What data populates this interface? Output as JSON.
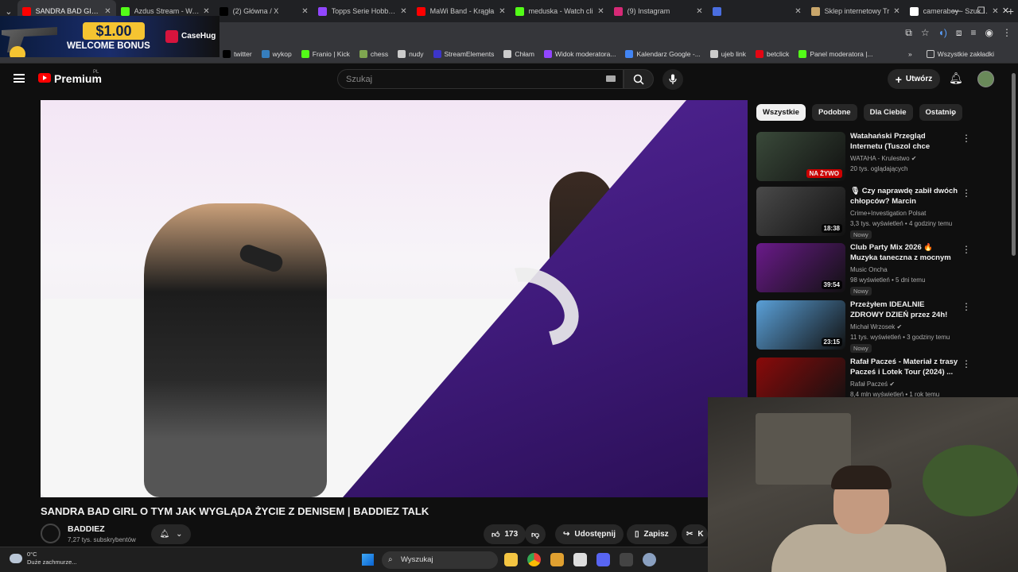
{
  "browser": {
    "tabs": [
      {
        "label": "SANDRA BAD GIRL O",
        "icon": "youtube-icon",
        "color": "#ff0000",
        "active": true
      },
      {
        "label": "Azdus Stream - Watc",
        "icon": "kick-icon",
        "color": "#53fc18",
        "active": false
      },
      {
        "label": "(2) Główna / X",
        "icon": "x-icon",
        "color": "#000000",
        "active": false
      },
      {
        "label": "Topps Serie Hobby B",
        "icon": "twitch-icon",
        "color": "#9146ff",
        "active": false
      },
      {
        "label": "MaWi Band - Krągła",
        "icon": "youtube-icon",
        "color": "#ff0000",
        "active": false
      },
      {
        "label": "meduska - Watch cli",
        "icon": "kick-icon",
        "color": "#53fc18",
        "active": false
      },
      {
        "label": "(9) Instagram",
        "icon": "instagram-icon",
        "color": "#d62976",
        "active": false
      },
      {
        "label": "",
        "icon": "window-icon",
        "color": "#4a6ee0",
        "active": false
      },
      {
        "label": "Sklep internetowy Tr",
        "icon": "shop-icon",
        "color": "#c9a66b",
        "active": false
      },
      {
        "label": "cameraboy - Szukaj w",
        "icon": "google-icon",
        "color": "#ffffff",
        "active": false
      }
    ],
    "bookmarks": [
      {
        "label": "twitter",
        "icon": "x-icon",
        "color": "#000000"
      },
      {
        "label": "wykop",
        "icon": "wykop-icon",
        "color": "#367ebd"
      },
      {
        "label": "Franio | Kick",
        "icon": "kick-icon",
        "color": "#53fc18"
      },
      {
        "label": "chess",
        "icon": "pawn-icon",
        "color": "#7fa650"
      },
      {
        "label": "nudy",
        "icon": "folder-icon",
        "color": "#cccccc"
      },
      {
        "label": "StreamElements",
        "icon": "streamelements-icon",
        "color": "#3c35c8"
      },
      {
        "label": "Chłam",
        "icon": "globe-icon",
        "color": "#cccccc"
      },
      {
        "label": "Widok moderatora...",
        "icon": "twitch-icon",
        "color": "#9146ff"
      },
      {
        "label": "Kalendarz Google -...",
        "icon": "calendar-icon",
        "color": "#4285f4"
      },
      {
        "label": "ujeb link",
        "icon": "globe-icon",
        "color": "#cccccc"
      },
      {
        "label": "betclick",
        "icon": "betclick-icon",
        "color": "#e30613"
      },
      {
        "label": "Panel moderatora |...",
        "icon": "kick-icon",
        "color": "#53fc18"
      }
    ],
    "bookmarks_other": "Wszystkie zakładki"
  },
  "ad": {
    "price": "$1.00",
    "bonus": "WELCOME BONUS",
    "brand": "CaseHug"
  },
  "youtube": {
    "logo": "Premium",
    "region": "PL",
    "search_placeholder": "Szukaj",
    "create_label": "Utwórz"
  },
  "video": {
    "title": "SANDRA BAD GIRL O TYM JAK WYGLĄDA ŻYCIE Z DENISEM | BADDIEZ TALK",
    "channel": "BADDIEZ",
    "subscribers": "7,27 tys. subskrybentów",
    "likes": "173",
    "share_label": "Udostępnij",
    "save_label": "Zapisz",
    "clip_label": "K"
  },
  "chips": [
    "Wszystkie",
    "Podobne",
    "Dla Ciebie",
    "Ostatnio"
  ],
  "recommendations": [
    {
      "title": "Watahański Przegląd Internetu (Tuszol chce pozwać ...",
      "channel": "WATAHA - Krulestwo",
      "meta": "20 tys. oglądających",
      "badge": "NA ŻYWO",
      "is_new": false,
      "verified": true,
      "thumb_color": "#3a4a3a"
    },
    {
      "title": "🎙 Czy naprawdę zabił dwóch chłopców? Marcin Chmielews...",
      "channel": "Crime+Investigation Polsat",
      "meta": "3,3 tys. wyświetleń • 4 godziny temu",
      "badge": "18:38",
      "is_new": true,
      "verified": false,
      "thumb_color": "#4a4a4a"
    },
    {
      "title": "Club Party Mix 2026 🔥 Muzyka taneczna z mocnym basem | ...",
      "channel": "Music Oncha",
      "meta": "98 wyświetleń • 5 dni temu",
      "badge": "39:54",
      "is_new": true,
      "verified": false,
      "thumb_color": "#6a1a8a"
    },
    {
      "title": "Przeżyłem IDEALNIE ZDROWY DZIEŃ przez 24h!",
      "channel": "Michał Wrzosek",
      "meta": "11 tys. wyświetleń • 3 godziny temu",
      "badge": "23:15",
      "is_new": true,
      "verified": true,
      "thumb_color": "#5aa0d8"
    },
    {
      "title": "Rafał Pacześ - Materiał z trasy Pacześ i Lotek Tour (2024) ...",
      "channel": "Rafał Pacześ",
      "meta": "8,4 mln wyświetleń • 1 rok temu",
      "badge": "",
      "is_new": false,
      "verified": true,
      "thumb_color": "#8a0a0a"
    }
  ],
  "new_label": "Nowy",
  "taskbar": {
    "temp": "0°C",
    "weather": "Duże zachmurze...",
    "search_label": "Wyszukaj"
  }
}
